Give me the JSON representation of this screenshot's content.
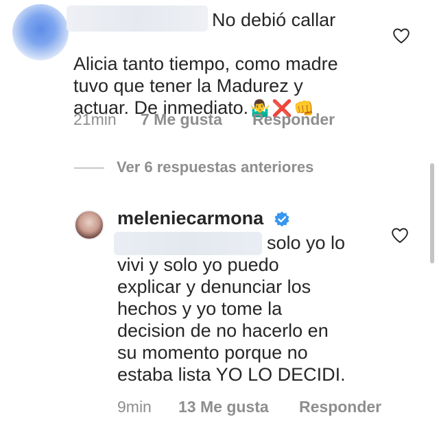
{
  "comment1": {
    "text_first_line": "No debió callar",
    "text_rest": "Alicia tanto tiempo, como madre\ntuvo que tener la Madurez y\nactuar. De inmediato.",
    "emojis": [
      "🤷‍♂️",
      "❌",
      "👊"
    ],
    "time": "21min",
    "likes": "7 Me gusta",
    "reply_label": "Responder"
  },
  "view_previous_replies": "Ver 6 respuestas anteriores",
  "reply": {
    "username": "meleniecarmona",
    "verified": true,
    "text_first_line": "solo yo lo",
    "text_rest": "vivi y solo yo puedo\nexplicar y denunciar los\nhechos y yo tome la\ndecision de no hacerlo en\nsu momento porque no\nestaba lista YO LO DECIDI.",
    "time": "9min",
    "likes": "13 Me gusta",
    "reply_label": "Responder"
  },
  "colors": {
    "text": "#262626",
    "secondary": "#8e8e8e",
    "verified_blue": "#3897f0"
  },
  "icons": [
    "heart-icon",
    "verified-badge-icon"
  ]
}
